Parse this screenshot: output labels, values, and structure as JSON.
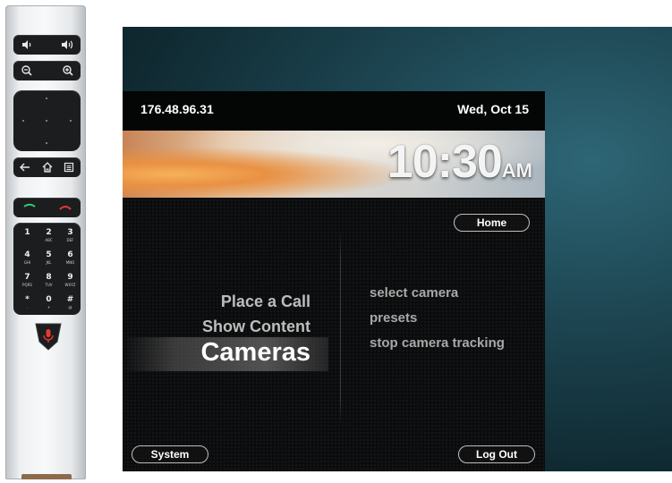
{
  "remote": {
    "icons": [
      "volume-down-icon",
      "volume-up-icon",
      "zoom-out-icon",
      "zoom-in-icon",
      "back-icon",
      "home-icon",
      "menu-icon",
      "call-icon",
      "hangup-icon",
      "mute-icon"
    ],
    "keypad": [
      {
        "digit": "1",
        "letters": ""
      },
      {
        "digit": "2",
        "letters": "ABC"
      },
      {
        "digit": "3",
        "letters": "DEF"
      },
      {
        "digit": "4",
        "letters": "GHI"
      },
      {
        "digit": "5",
        "letters": "JKL"
      },
      {
        "digit": "6",
        "letters": "MNO"
      },
      {
        "digit": "7",
        "letters": "PQRS"
      },
      {
        "digit": "8",
        "letters": "TUV"
      },
      {
        "digit": "9",
        "letters": "WXYZ"
      },
      {
        "digit": "*",
        "letters": "."
      },
      {
        "digit": "0",
        "letters": "+"
      },
      {
        "digit": "#",
        "letters": "@"
      }
    ],
    "colors": {
      "call": "#2ecc71",
      "hangup": "#e53935",
      "mute": "#e53935"
    }
  },
  "screen": {
    "ip": "176.48.96.31",
    "date": "Wed, Oct 15",
    "time": "10:30",
    "ampm": "AM",
    "home_label": "Home",
    "menu": {
      "item1": "Place a Call",
      "item2": "Show Content",
      "selected": "Cameras"
    },
    "submenu": {
      "item1": "select camera",
      "item2": "presets",
      "item3": "stop camera tracking"
    },
    "system_label": "System",
    "logout_label": "Log Out"
  }
}
